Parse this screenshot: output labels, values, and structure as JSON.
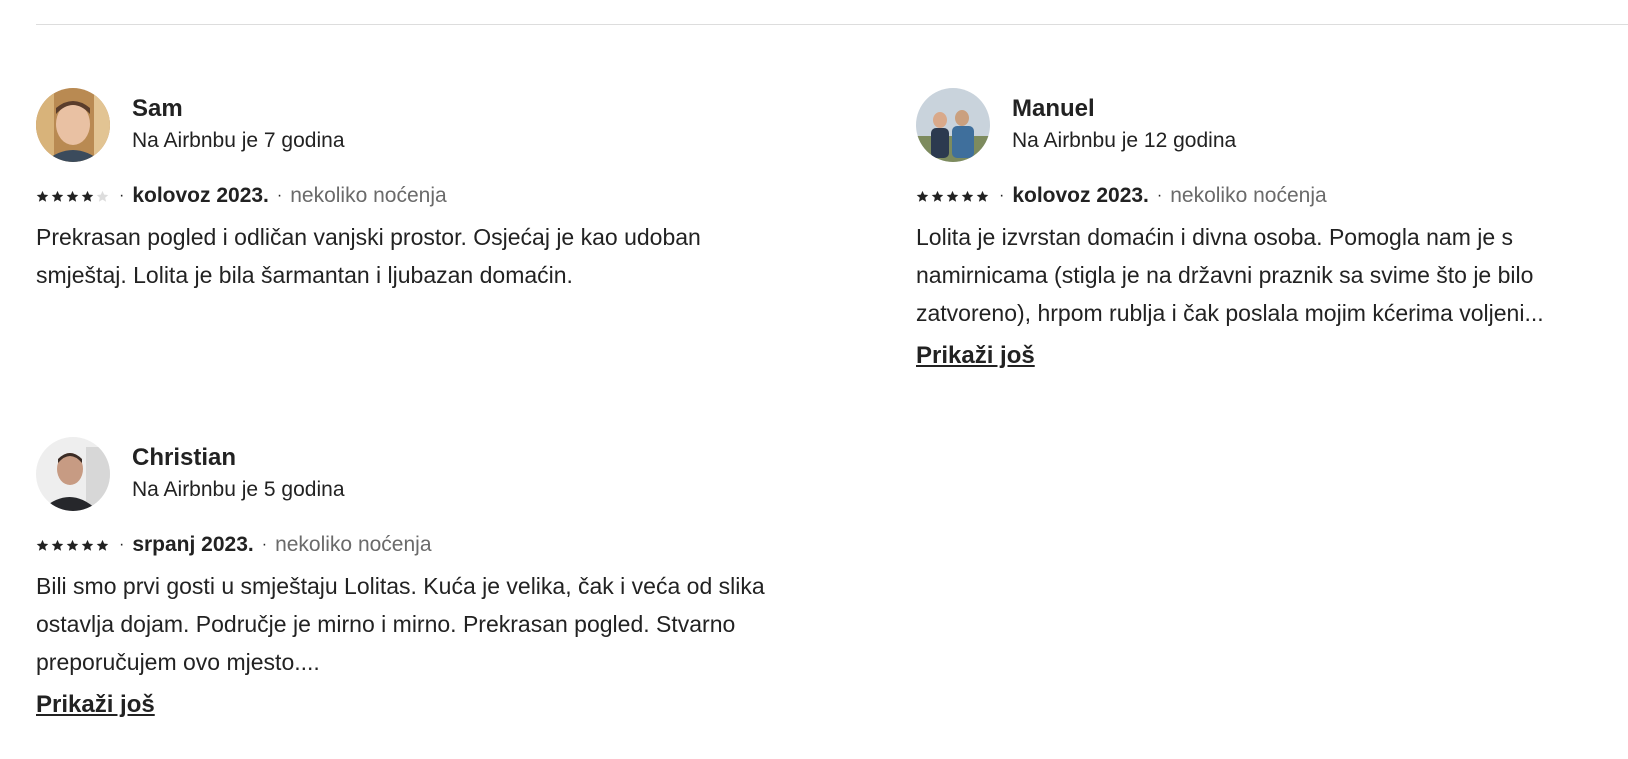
{
  "reviews": [
    {
      "name": "Sam",
      "tenure": "Na Airbnbu je 7 godina",
      "rating": 4,
      "date": "kolovoz 2023.",
      "stay": "nekoliko noćenja",
      "text": "Prekrasan pogled i odličan vanjski prostor. Osjećaj je kao udoban smještaj. Lolita je bila šarmantan i ljubazan domaćin.",
      "show_more": ""
    },
    {
      "name": "Manuel",
      "tenure": "Na Airbnbu je 12 godina",
      "rating": 5,
      "date": "kolovoz 2023.",
      "stay": "nekoliko noćenja",
      "text": "Lolita je izvrstan domaćin i divna osoba. Pomogla nam je s namirnicama (stigla je na državni praznik sa svime što je bilo zatvoreno), hrpom rublja i čak poslala mojim kćerima voljeni...",
      "show_more": "Prikaži još"
    },
    {
      "name": "Christian",
      "tenure": "Na Airbnbu je 5 godina",
      "rating": 5,
      "date": "srpanj 2023.",
      "stay": "nekoliko noćenja",
      "text": "Bili smo prvi gosti u smještaju Lolitas. Kuća je velika, čak i veća od slika ostavlja dojam. Područje je mirno i mirno. Prekrasan pogled. Stvarno preporučujem ovo mjesto....",
      "show_more": "Prikaži još"
    }
  ],
  "colors": {
    "text": "#222222",
    "muted": "#6a6a6a",
    "star": "#222222",
    "star_empty": "#dddddd",
    "divider": "#dddddd"
  },
  "separator": "·"
}
